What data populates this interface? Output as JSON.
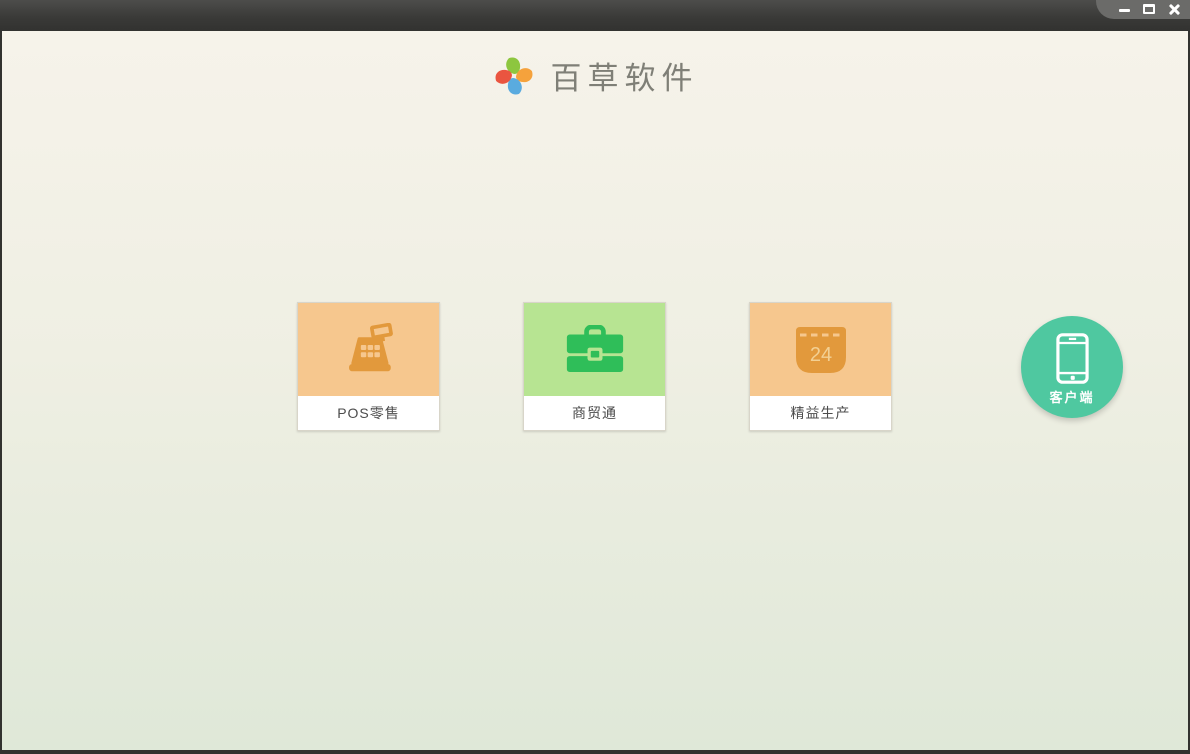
{
  "window": {
    "controls": {
      "minimize": "minimize-icon",
      "maximize": "maximize-icon",
      "close": "close-icon"
    }
  },
  "brand": {
    "name": "百草软件",
    "logo": {
      "icon": "pinwheel-logo-icon",
      "petal_colors": {
        "top": "#8dc63f",
        "right": "#f5a23c",
        "bottom": "#5aabdf",
        "left": "#ea5540"
      }
    }
  },
  "products": [
    {
      "label": "POS零售",
      "icon": "cash-register-icon",
      "tile_bg": "#f6c78e",
      "icon_color": "#e2993c"
    },
    {
      "label": "商贸通",
      "icon": "briefcase-icon",
      "tile_bg": "#b7e492",
      "icon_color": "#2fbe59"
    },
    {
      "label": "精益生产",
      "icon": "calendar-icon",
      "calendar_day": "24",
      "tile_bg": "#f6c78e",
      "icon_color": "#e2993c"
    }
  ],
  "client_button": {
    "label": "客户端",
    "icon": "smartphone-icon",
    "color": "#4fc8a0"
  }
}
